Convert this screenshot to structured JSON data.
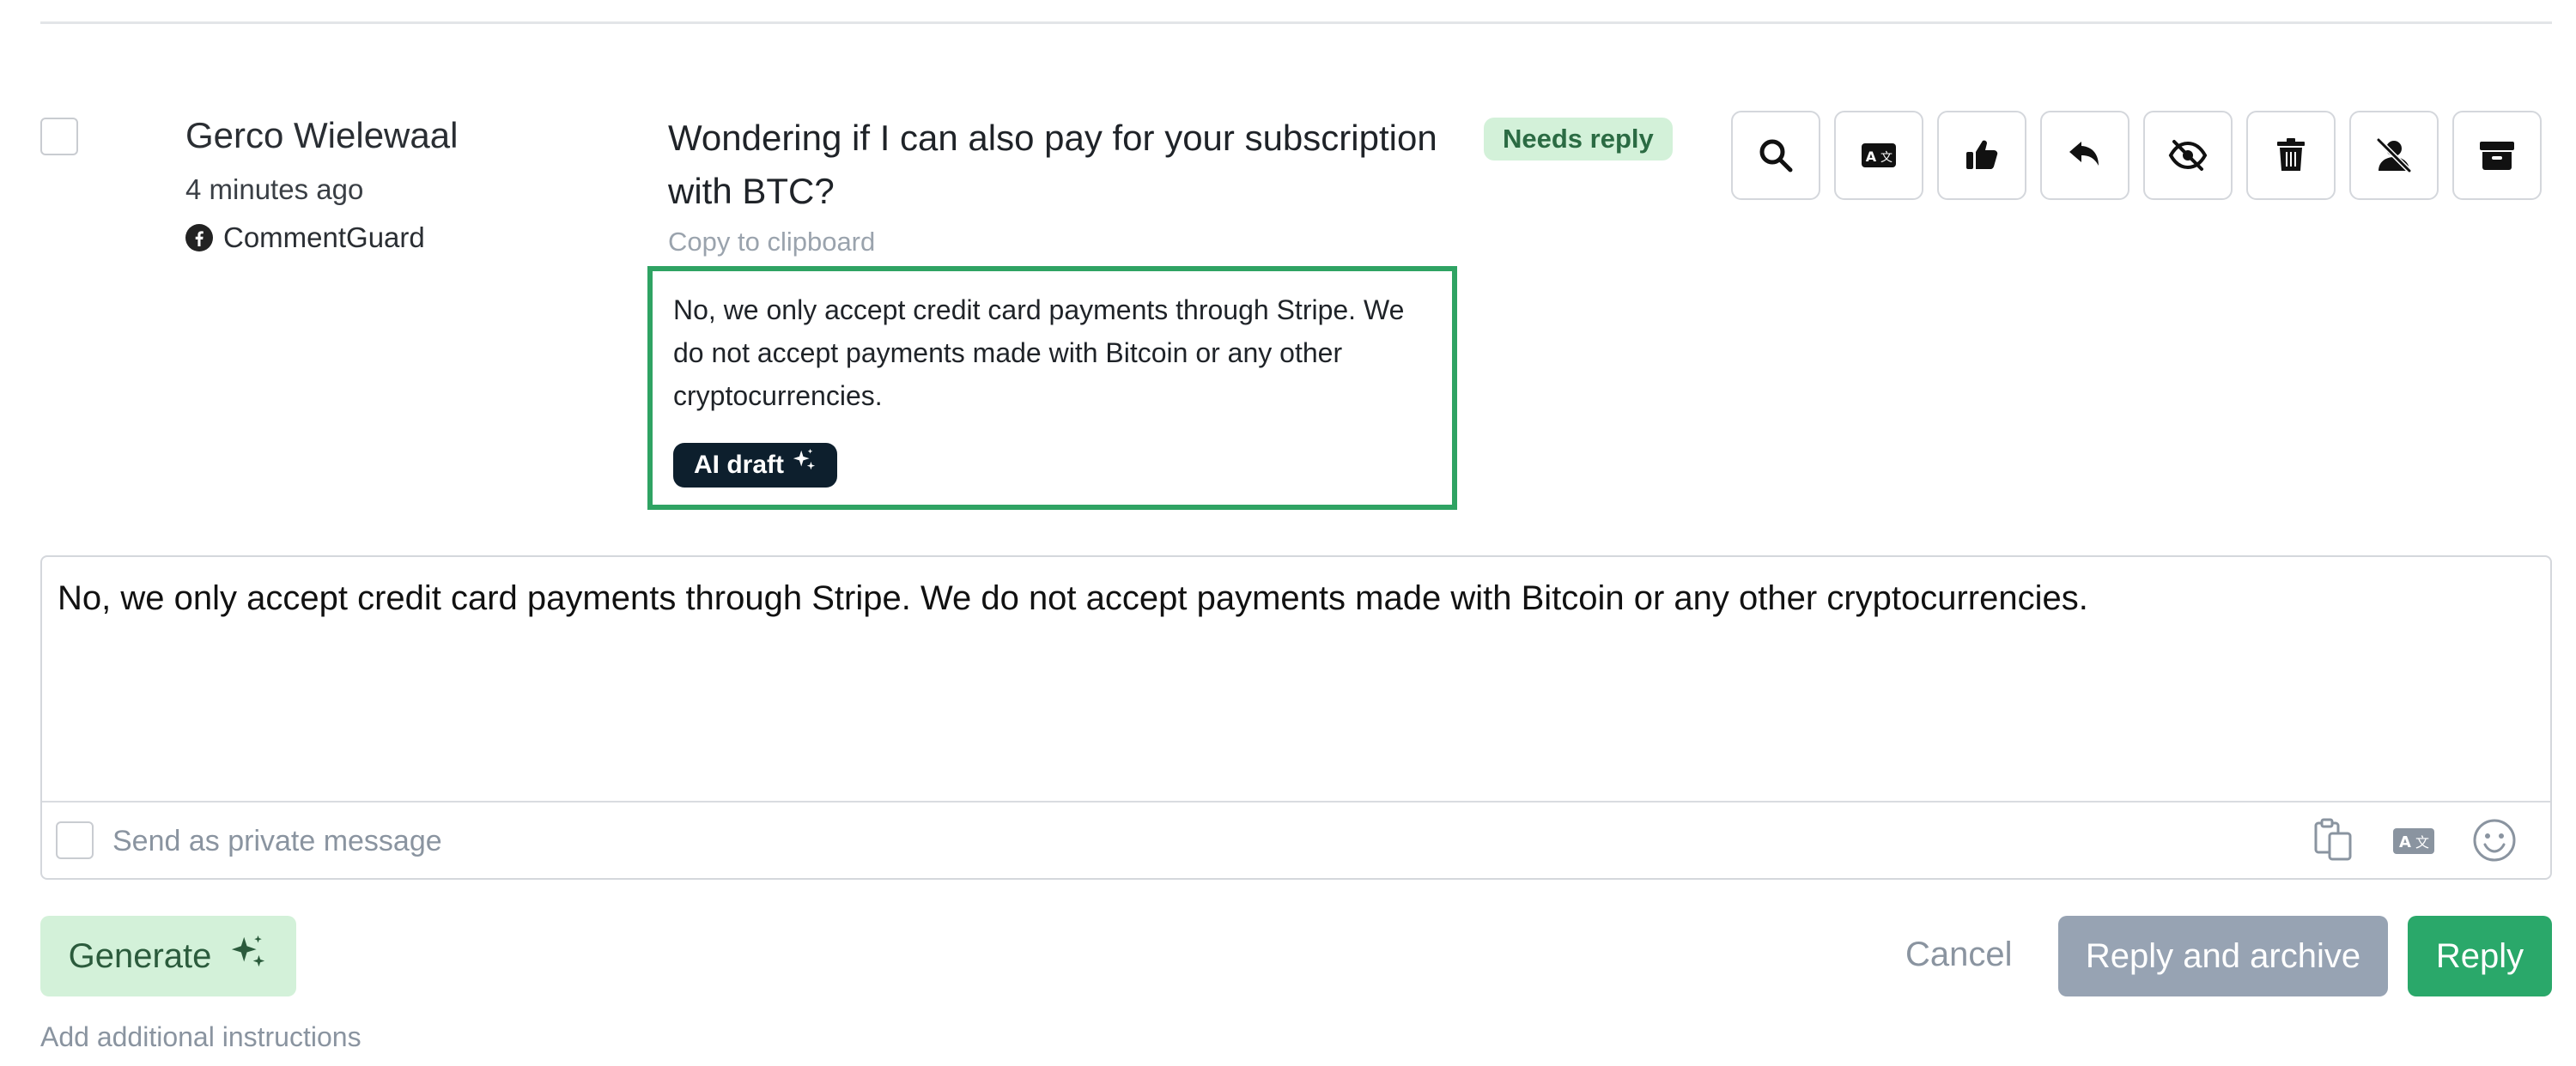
{
  "comment": {
    "author": "Gerco Wielewaal",
    "time_ago": "4 minutes ago",
    "source": "CommentGuard",
    "source_icon": "facebook-icon",
    "text": "Wondering if I can also pay for your subscription with BTC?",
    "status": "Needs reply",
    "copy_label": "Copy to clipboard"
  },
  "draft": {
    "text": "No, we only accept credit card payments through Stripe. We do not accept payments made with Bitcoin or any other cryptocurrencies.",
    "badge": "AI draft",
    "badge_icon": "sparkle-icon"
  },
  "actions": [
    {
      "icon": "search-icon"
    },
    {
      "icon": "translate-icon"
    },
    {
      "icon": "thumbs-up-icon"
    },
    {
      "icon": "reply-icon"
    },
    {
      "icon": "hide-icon"
    },
    {
      "icon": "trash-icon"
    },
    {
      "icon": "block-user-icon"
    },
    {
      "icon": "archive-icon"
    }
  ],
  "reply_box": {
    "value": "No, we only accept credit card payments through Stripe. We do not accept payments made with Bitcoin or any other cryptocurrencies.",
    "private_label": "Send as private message",
    "tools": [
      "clipboard-icon",
      "translate-icon",
      "emoji-icon"
    ]
  },
  "footer": {
    "generate_label": "Generate",
    "add_instructions": "Add additional instructions",
    "cancel_label": "Cancel",
    "reply_archive_label": "Reply and archive",
    "reply_label": "Reply"
  },
  "colors": {
    "accent_green": "#2aa86a",
    "draft_border": "#2fa363",
    "badge_bg": "#d3f1d9",
    "muted": "#8a94a0",
    "secondary_button": "#97a3b3"
  }
}
